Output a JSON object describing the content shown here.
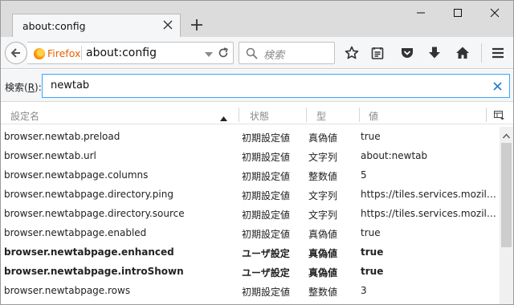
{
  "tab": {
    "title": "about:config"
  },
  "navbar": {
    "identity_label": "Firefox",
    "url": "about:config",
    "search_placeholder": "検索"
  },
  "filter": {
    "label_prefix": "検索(",
    "label_accesskey": "R",
    "label_suffix": "):",
    "value": "newtab"
  },
  "columns": {
    "name": "設定名",
    "status": "状態",
    "type": "型",
    "value": "値"
  },
  "rows": [
    {
      "name": "browser.newtab.preload",
      "status": "初期設定値",
      "type": "真偽値",
      "value": "true",
      "modified": false
    },
    {
      "name": "browser.newtab.url",
      "status": "初期設定値",
      "type": "文字列",
      "value": "about:newtab",
      "modified": false
    },
    {
      "name": "browser.newtabpage.columns",
      "status": "初期設定値",
      "type": "整数値",
      "value": "5",
      "modified": false
    },
    {
      "name": "browser.newtabpage.directory.ping",
      "status": "初期設定値",
      "type": "文字列",
      "value": "https://tiles.services.mozilla.co...",
      "modified": false
    },
    {
      "name": "browser.newtabpage.directory.source",
      "status": "初期設定値",
      "type": "文字列",
      "value": "https://tiles.services.mozilla.co...",
      "modified": false
    },
    {
      "name": "browser.newtabpage.enabled",
      "status": "初期設定値",
      "type": "真偽値",
      "value": "true",
      "modified": false
    },
    {
      "name": "browser.newtabpage.enhanced",
      "status": "ユーザ設定",
      "type": "真偽値",
      "value": "true",
      "modified": true
    },
    {
      "name": "browser.newtabpage.introShown",
      "status": "ユーザ設定",
      "type": "真偽値",
      "value": "true",
      "modified": true
    },
    {
      "name": "browser.newtabpage.rows",
      "status": "初期設定値",
      "type": "整数値",
      "value": "3",
      "modified": false
    }
  ],
  "icons": {
    "tab_close": "close-icon",
    "new_tab": "plus-icon",
    "minimize": "minimize-icon",
    "maximize": "maximize-icon",
    "close": "close-icon",
    "back": "back-arrow-icon",
    "reload": "reload-icon",
    "search": "search-icon",
    "bookmark": "star-icon",
    "reading_list": "reading-list-icon",
    "pocket": "pocket-icon",
    "download": "download-icon",
    "home": "home-icon",
    "menu": "hamburger-menu-icon",
    "clear": "clear-icon",
    "sort": "sort-ascending-icon",
    "column_picker": "column-picker-icon"
  },
  "colors": {
    "focus_border": "#3aa6ff",
    "identity": "#e66000",
    "chrome": "#f5f6f7"
  }
}
